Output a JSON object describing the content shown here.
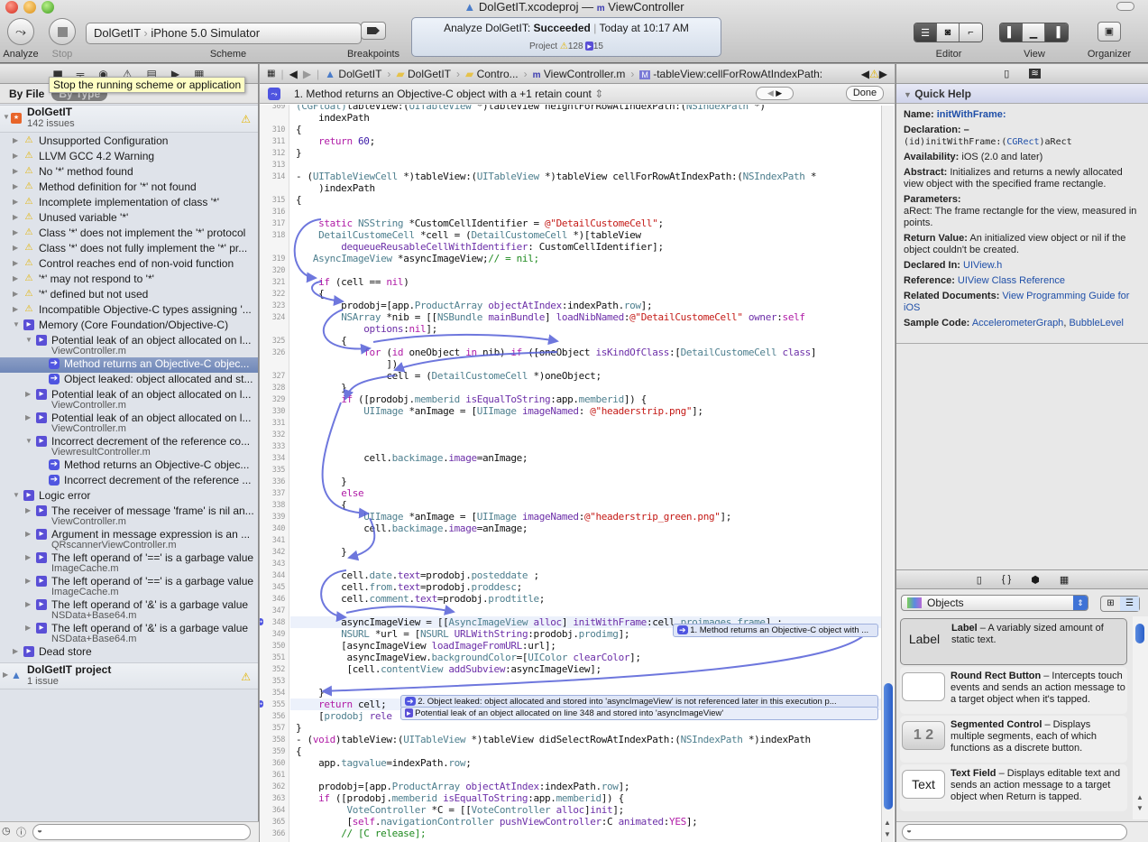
{
  "window": {
    "title_project": "DolGetIT.xcodeproj",
    "title_sep": "—",
    "title_file": "ViewController"
  },
  "toolbar": {
    "analyze_label": "Analyze",
    "stop_label": "Stop",
    "scheme_target": "DolGetIT",
    "scheme_device": "iPhone 5.0 Simulator",
    "scheme_label": "Scheme",
    "breakpoints_label": "Breakpoints",
    "activity_prefix": "Analyze DolGetIT:",
    "activity_status": "Succeeded",
    "activity_time": "Today at 10:17 AM",
    "activity_project_label": "Project",
    "warning_count": "128",
    "analyzer_count": "15",
    "editor_label": "Editor",
    "view_label": "View",
    "organizer_label": "Organizer"
  },
  "tooltip": "Stop the running scheme or application",
  "navigator": {
    "filter_by_file": "By File",
    "filter_by_type": "By Type",
    "project_name": "DolGetIT",
    "project_issue_count": "142 issues",
    "issues": [
      {
        "label": "Unsupported Configuration",
        "kind": "warning",
        "level": 1
      },
      {
        "label": "LLVM GCC 4.2 Warning",
        "kind": "warning",
        "level": 1
      },
      {
        "label": "No '*' method found",
        "kind": "warning",
        "level": 1
      },
      {
        "label": "Method definition for '*' not found",
        "kind": "warning",
        "level": 1
      },
      {
        "label": "Incomplete implementation of class '*'",
        "kind": "warning",
        "level": 1
      },
      {
        "label": "Unused variable '*'",
        "kind": "warning",
        "level": 1
      },
      {
        "label": "Class '*' does not implement the '*' protocol",
        "kind": "warning",
        "level": 1
      },
      {
        "label": "Class '*' does not fully implement the '*' pr...",
        "kind": "warning",
        "level": 1
      },
      {
        "label": "Control reaches end of non-void function",
        "kind": "warning",
        "level": 1
      },
      {
        "label": "'*' may not respond to '*'",
        "kind": "warning",
        "level": 1
      },
      {
        "label": "'*' defined but not used",
        "kind": "warning",
        "level": 1
      },
      {
        "label": "Incompatible Objective-C types assigning '...",
        "kind": "warning",
        "level": 1
      },
      {
        "label": "Memory (Core Foundation/Objective-C)",
        "kind": "analyzer",
        "level": 1,
        "expanded": true
      },
      {
        "label": "Potential leak of an object allocated on l...",
        "file": "ViewController.m",
        "kind": "analyzer",
        "level": 2,
        "expanded": true
      },
      {
        "label": "Method returns an Objective-C objec...",
        "kind": "step",
        "level": 3,
        "selected": true
      },
      {
        "label": "Object leaked: object allocated and st...",
        "kind": "step",
        "level": 3
      },
      {
        "label": "Potential leak of an object allocated on l...",
        "file": "ViewController.m",
        "kind": "analyzer",
        "level": 2
      },
      {
        "label": "Potential leak of an object allocated on l...",
        "file": "ViewController.m",
        "kind": "analyzer",
        "level": 2
      },
      {
        "label": "Incorrect decrement of the reference co...",
        "file": "ViewresultController.m",
        "kind": "analyzer",
        "level": 2,
        "expanded": true
      },
      {
        "label": "Method returns an Objective-C objec...",
        "kind": "step",
        "level": 3
      },
      {
        "label": "Incorrect decrement of the reference ...",
        "kind": "step",
        "level": 3
      },
      {
        "label": "Logic error",
        "kind": "analyzer",
        "level": 1,
        "expanded": true
      },
      {
        "label": "The receiver of message 'frame' is nil an...",
        "file": "ViewController.m",
        "kind": "analyzer",
        "level": 2
      },
      {
        "label": "Argument in message expression is an ...",
        "file": "QRscannerViewController.m",
        "kind": "analyzer",
        "level": 2
      },
      {
        "label": "The left operand of '==' is a garbage value",
        "file": "ImageCache.m",
        "kind": "analyzer",
        "level": 2
      },
      {
        "label": "The left operand of '==' is a garbage value",
        "file": "ImageCache.m",
        "kind": "analyzer",
        "level": 2
      },
      {
        "label": "The left operand of '&' is a garbage value",
        "file": "NSData+Base64.m",
        "kind": "analyzer",
        "level": 2
      },
      {
        "label": "The left operand of '&' is a garbage value",
        "file": "NSData+Base64.m",
        "kind": "analyzer",
        "level": 2
      },
      {
        "label": "Dead store",
        "kind": "analyzer",
        "level": 1
      }
    ],
    "project2_name": "DolGetIT project",
    "project2_issue_count": "1 issue",
    "filter_placeholder": ""
  },
  "jumpbar": {
    "crumbs": [
      "DolGetIT",
      "DolGetIT",
      "Contro...",
      "ViewController.m",
      "-tableView:cellForRowAtIndexPath:"
    ]
  },
  "issuebar": {
    "message": "1. Method returns an Objective-C object with a +1 retain count",
    "done_label": "Done"
  },
  "code": {
    "lines": [
      {
        "n": "309",
        "html": "<span class='t'>(CGFloat)</span>tableView:(<span class='t'>UITableView</span> *)tableView heightForRowAtIndexPath:(<span class='t'>NSIndexPath</span> *)"
      },
      {
        "n": "",
        "html": "    indexPath"
      },
      {
        "n": "310",
        "html": "{"
      },
      {
        "n": "311",
        "html": "    <span class='k'>return</span> <span class='n'>60</span>;"
      },
      {
        "n": "312",
        "html": "}"
      },
      {
        "n": "313",
        "html": ""
      },
      {
        "n": "314",
        "html": "- (<span class='t'>UITableViewCell</span> *)tableView:(<span class='t'>UITableView</span> *)tableView cellForRowAtIndexPath:(<span class='t'>NSIndexPath</span> *"
      },
      {
        "n": "",
        "html": "    )indexPath"
      },
      {
        "n": "315",
        "html": "{"
      },
      {
        "n": "316",
        "html": ""
      },
      {
        "n": "317",
        "html": "    <span class='k'>static</span> <span class='t'>NSString</span> *CustomCellIdentifier = <span class='s'>@\"DetailCustomeCell\"</span>;"
      },
      {
        "n": "318",
        "html": "    <span class='t'>DetailCustomeCell</span> *cell = (<span class='t'>DetailCustomeCell</span> *)[tableView"
      },
      {
        "n": "",
        "html": "        <span class='m'>dequeueReusableCellWithIdentifier</span>: CustomCellIdentifier];"
      },
      {
        "n": "319",
        "html": "   <span class='t'>AsyncImageView</span> *asyncImageView;<span class='c'>// = nil;</span>"
      },
      {
        "n": "320",
        "html": ""
      },
      {
        "n": "321",
        "html": "    <span class='k'>if</span> (cell == <span class='k'>nil</span>)"
      },
      {
        "n": "322",
        "html": "    {"
      },
      {
        "n": "323",
        "html": "        prodobj=[app.<span class='t'>ProductArray</span> <span class='m'>objectAtIndex</span>:indexPath.<span class='t'>row</span>];"
      },
      {
        "n": "324",
        "html": "        <span class='t'>NSArray</span> *nib = [[<span class='t'>NSBundle</span> <span class='m'>mainBundle</span>] <span class='m'>loadNibNamed</span>:<span class='s'>@\"DetailCustomeCell\"</span> <span class='m'>owner</span>:<span class='k'>self</span>"
      },
      {
        "n": "",
        "html": "            <span class='m'>options</span>:<span class='k'>nil</span>];"
      },
      {
        "n": "325",
        "html": "        {"
      },
      {
        "n": "326",
        "html": "            <span class='k'>for</span> (<span class='k'>id</span> oneObject <span class='k'>in</span> nib) <span class='k'>if</span> ([oneObject <span class='m'>isKindOfClass</span>:[<span class='t'>DetailCustomeCell</span> <span class='m'>class</span>]"
      },
      {
        "n": "",
        "html": "                ])"
      },
      {
        "n": "327",
        "html": "                cell = (<span class='t'>DetailCustomeCell</span> *)oneObject;"
      },
      {
        "n": "328",
        "html": "        }"
      },
      {
        "n": "329",
        "html": "        <span class='k'>if</span> ([prodobj.<span class='t'>memberid</span> <span class='m'>isEqualToString</span>:app.<span class='t'>memberid</span>]) {"
      },
      {
        "n": "330",
        "html": "            <span class='t'>UIImage</span> *anImage = [<span class='t'>UIImage</span> <span class='m'>imageNamed</span>: <span class='s'>@\"headerstrip.png\"</span>];"
      },
      {
        "n": "331",
        "html": ""
      },
      {
        "n": "332",
        "html": ""
      },
      {
        "n": "333",
        "html": ""
      },
      {
        "n": "334",
        "html": "            cell.<span class='t'>backimage</span>.<span class='m'>image</span>=anImage;"
      },
      {
        "n": "335",
        "html": ""
      },
      {
        "n": "336",
        "html": "        }"
      },
      {
        "n": "337",
        "html": "        <span class='k'>else</span>"
      },
      {
        "n": "338",
        "html": "        {"
      },
      {
        "n": "339",
        "html": "            <span class='t'>UIImage</span> *anImage = [<span class='t'>UIImage</span> <span class='m'>imageNamed</span>:<span class='s'>@\"headerstrip_green.png\"</span>];"
      },
      {
        "n": "340",
        "html": "            cell.<span class='t'>backimage</span>.<span class='m'>image</span>=anImage;"
      },
      {
        "n": "341",
        "html": ""
      },
      {
        "n": "342",
        "html": "        }"
      },
      {
        "n": "343",
        "html": ""
      },
      {
        "n": "344",
        "html": "        cell.<span class='t'>date</span>.<span class='m'>text</span>=prodobj.<span class='t'>posteddate</span> ;"
      },
      {
        "n": "345",
        "html": "        cell.<span class='t'>from</span>.<span class='m'>text</span>=prodobj.<span class='t'>proddesc</span>;"
      },
      {
        "n": "346",
        "html": "        cell.<span class='t'>comment</span>.<span class='m'>text</span>=prodobj.<span class='t'>prodtitle</span>;"
      },
      {
        "n": "347",
        "html": ""
      },
      {
        "n": "348",
        "html": "        asyncImageView = [[<span class='t'>AsyncImageView</span> <span class='m'>alloc</span>] <span class='m'>initWithFrame</span>:cell.<span class='t'>proimages</span>.<span class='t'>frame</span>] ;",
        "hl": true,
        "marker": true
      },
      {
        "n": "349",
        "html": "        <span class='t'>NSURL</span> *url = [<span class='t'>NSURL</span> <span class='m'>URLWithString</span>:prodobj.<span class='t'>prodimg</span>];"
      },
      {
        "n": "350",
        "html": "        [asyncImageView <span class='m'>loadImageFromURL</span>:url];"
      },
      {
        "n": "351",
        "html": "         asyncImageView.<span class='t'>backgroundColor</span>=[<span class='t'>UIColor</span> <span class='m'>clearColor</span>];"
      },
      {
        "n": "352",
        "html": "         [cell.<span class='t'>contentView</span> <span class='m'>addSubview</span>:asyncImageView];"
      },
      {
        "n": "353",
        "html": ""
      },
      {
        "n": "354",
        "html": "    }"
      },
      {
        "n": "355",
        "html": "    <span class='k'>return</span> cell;",
        "hl": true,
        "marker": true
      },
      {
        "n": "356",
        "html": "    [<span class='t'>prodobj</span> <span class='m'>rele</span>"
      },
      {
        "n": "357",
        "html": "}"
      },
      {
        "n": "358",
        "html": "- (<span class='k'>void</span>)tableView:(<span class='t'>UITableView</span> *)tableView didSelectRowAtIndexPath:(<span class='t'>NSIndexPath</span> *)indexPath"
      },
      {
        "n": "359",
        "html": "{"
      },
      {
        "n": "360",
        "html": "    app.<span class='t'>tagvalue</span>=indexPath.<span class='t'>row</span>;"
      },
      {
        "n": "361",
        "html": ""
      },
      {
        "n": "362",
        "html": "    prodobj=[app.<span class='t'>ProductArray</span> <span class='m'>objectAtIndex</span>:indexPath.<span class='t'>row</span>];"
      },
      {
        "n": "363",
        "html": "    <span class='k'>if</span> ([prodobj.<span class='t'>memberid</span> <span class='m'>isEqualToString</span>:app.<span class='t'>memberid</span>]) {"
      },
      {
        "n": "364",
        "html": "         <span class='t'>VoteController</span> *C = [[<span class='t'>VoteController</span> <span class='m'>alloc</span>]<span class='m'>init</span>];"
      },
      {
        "n": "365",
        "html": "         [<span class='k'>self</span>.<span class='t'>navigationController</span> <span class='m'>pushViewController</span>:C <span class='m'>animated</span>:<span class='k'>YES</span>];"
      },
      {
        "n": "366",
        "html": "        <span class='c'>// [C release];</span>"
      }
    ],
    "bubble1": "1. Method returns an Objective-C object with ...",
    "bubble2": "2. Object leaked: object allocated and stored into 'asyncImageView' is not referenced later in this execution p...",
    "bubble3": "Potential leak of an object allocated on line 348 and stored into 'asyncImageView'"
  },
  "quick_help": {
    "header": "Quick Help",
    "name_label": "Name:",
    "name_value": "initWithFrame:",
    "declaration_label": "Declaration:",
    "declaration_dash": "–",
    "declaration_prefix": "(id)initWithFrame:(",
    "declaration_type": "CGRect",
    "declaration_suffix": ")aRect",
    "availability_label": "Availability:",
    "availability_value": "iOS (2.0 and later)",
    "abstract_label": "Abstract:",
    "abstract_value": "Initializes and returns a newly allocated view object with the specified frame rectangle.",
    "parameters_label": "Parameters:",
    "parameters_value": "aRect: The frame rectangle for the view, measured in points.",
    "return_label": "Return Value:",
    "return_value": "An initialized view object or nil if the object couldn't be created.",
    "declared_label": "Declared In:",
    "declared_value": "UIView.h",
    "reference_label": "Reference:",
    "reference_value": "UIView Class Reference",
    "related_label": "Related Documents:",
    "related_value": "View Programming Guide for iOS",
    "sample_label": "Sample Code:",
    "sample_value_1": "AccelerometerGraph",
    "sample_sep": ",",
    "sample_value_2": "BubbleLevel"
  },
  "library": {
    "selector_value": "Objects",
    "items": [
      {
        "thumb": "Label",
        "name": "Label",
        "desc": " – A variably sized amount of static text."
      },
      {
        "thumb": "",
        "name": "Round Rect Button",
        "desc": " – Intercepts touch events and sends an action message to a target object when it's tapped."
      },
      {
        "thumb": "1 2",
        "name": "Segmented Control",
        "desc": " – Displays multiple segments, each of which functions as a discrete button."
      },
      {
        "thumb": "Text",
        "name": "Text Field",
        "desc": " – Displays editable text and sends an action message to a target object when Return is tapped."
      }
    ]
  },
  "colors": {
    "analyzer_blue": "#4f55e0",
    "warning_yellow": "#e3b400",
    "selection": "#7890c0",
    "link": "#1f4fa8"
  }
}
